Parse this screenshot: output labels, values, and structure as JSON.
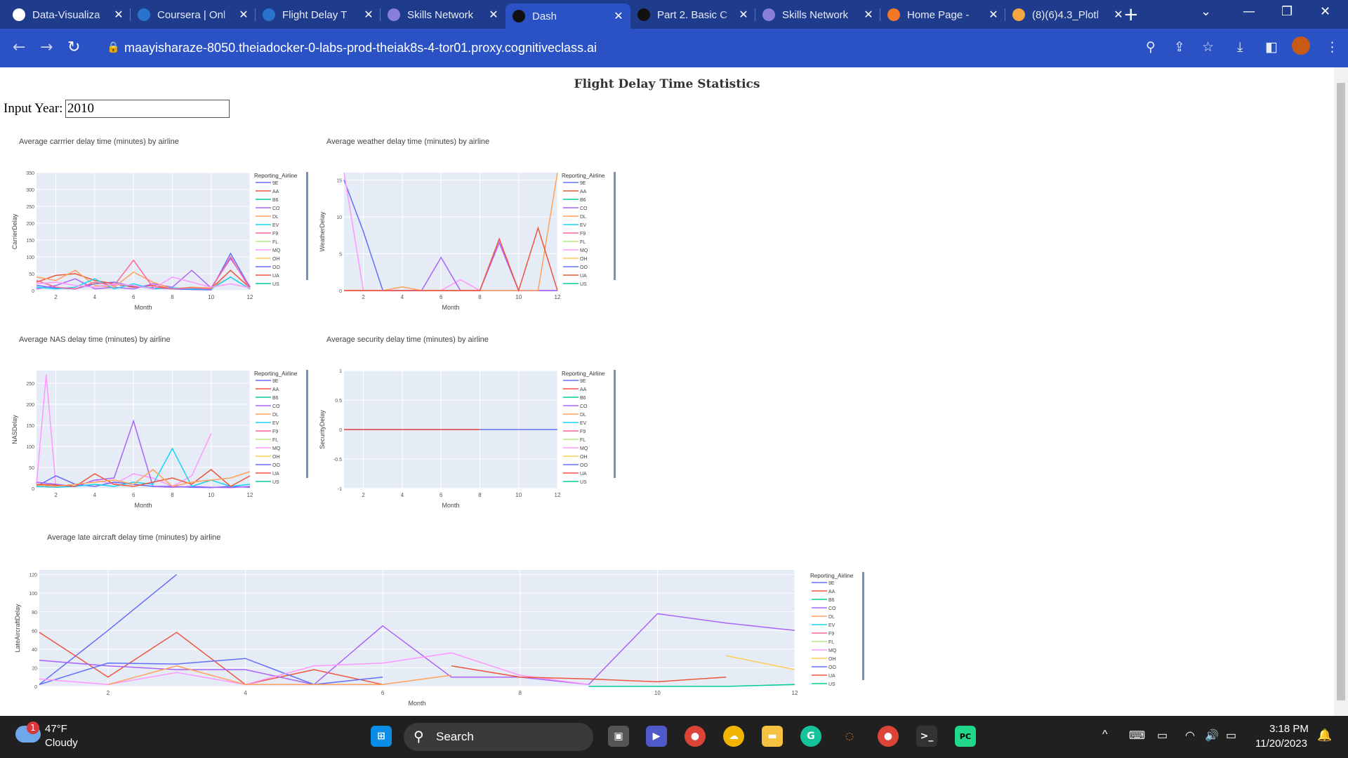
{
  "browser": {
    "tabs": [
      {
        "title": "Data-Visualiza",
        "icon": "github-icon",
        "color": "#ffffff"
      },
      {
        "title": "Coursera | Onl",
        "icon": "coursera-icon",
        "color": "#2a73cc"
      },
      {
        "title": "Flight Delay T",
        "icon": "coursera-icon",
        "color": "#2a73cc"
      },
      {
        "title": "Skills Network",
        "icon": "skills-network-icon",
        "color": "#8a7fd8"
      },
      {
        "title": "Dash",
        "icon": "dash-icon",
        "color": "#111111",
        "active": true
      },
      {
        "title": "Part 2. Basic C",
        "icon": "dash-icon",
        "color": "#111111"
      },
      {
        "title": "Skills Network",
        "icon": "skills-network-icon",
        "color": "#8a7fd8"
      },
      {
        "title": "Home Page - ",
        "icon": "jupyter-icon",
        "color": "#f37726"
      },
      {
        "title": "(8)(6)4.3_Plotl",
        "icon": "book-icon",
        "color": "#f2a541"
      }
    ],
    "url": "maayisharaze-8050.theiadocker-0-labs-prod-theiak8s-4-tor01.proxy.cognitiveclass.ai"
  },
  "page": {
    "title": "Flight Delay Time Statistics",
    "input_label": "Input Year:",
    "input_value": "2010"
  },
  "airlines": [
    "9E",
    "AA",
    "B6",
    "CO",
    "DL",
    "EV",
    "F9",
    "FL",
    "MQ",
    "OH",
    "OO",
    "UA",
    "US"
  ],
  "airline_colors": {
    "9E": "#636efa",
    "AA": "#ef553b",
    "B6": "#00cc96",
    "CO": "#ab63fa",
    "DL": "#ffa15a",
    "EV": "#19d3f3",
    "F9": "#ff6692",
    "FL": "#b6e880",
    "MQ": "#ff97ff",
    "OH": "#fecb52",
    "OO": "#636efa",
    "UA": "#ef553b",
    "US": "#00cc96"
  },
  "legend_title": "Reporting_Airline",
  "chart_data": [
    {
      "type": "line",
      "title": "Average carrrier delay time (minutes) by airline",
      "xlabel": "Month",
      "ylabel": "CarrierDelay",
      "xlim": [
        1,
        12
      ],
      "ylim": [
        0,
        350
      ],
      "xticks": [
        2,
        4,
        6,
        8,
        10,
        12
      ],
      "yticks": [
        0,
        50,
        100,
        150,
        200,
        250,
        300,
        350
      ],
      "series": [
        {
          "name": "9E",
          "x": [
            1,
            2,
            3,
            4,
            5,
            6,
            7,
            8,
            9,
            10,
            11,
            12
          ],
          "y": [
            15,
            8,
            5,
            20,
            25,
            12,
            8,
            5,
            3,
            2,
            110,
            10
          ]
        },
        {
          "name": "AA",
          "x": [
            1,
            2,
            3,
            4,
            5,
            6,
            7,
            8,
            9,
            10,
            11,
            12
          ],
          "y": [
            25,
            45,
            50,
            30,
            20,
            10,
            15,
            5,
            10,
            5,
            60,
            8
          ]
        },
        {
          "name": "CO",
          "x": [
            1,
            2,
            3,
            4,
            5,
            6,
            7,
            8,
            9,
            10,
            11,
            12
          ],
          "y": [
            5,
            15,
            35,
            5,
            10,
            5,
            20,
            10,
            60,
            8,
            95,
            12
          ]
        },
        {
          "name": "DL",
          "x": [
            1,
            2,
            3,
            4,
            5,
            6,
            7,
            8,
            9,
            10,
            11,
            12
          ],
          "y": [
            40,
            30,
            60,
            15,
            10,
            55,
            25,
            5,
            10,
            8,
            40,
            5
          ]
        },
        {
          "name": "EV",
          "x": [
            1,
            2,
            3,
            4,
            5,
            6,
            7,
            8,
            9,
            10,
            11,
            12
          ],
          "y": [
            10,
            5,
            10,
            35,
            5,
            20,
            5,
            8,
            5,
            5,
            40,
            5
          ]
        },
        {
          "name": "F9",
          "x": [
            1,
            2,
            3,
            4,
            5,
            6,
            7,
            8,
            9,
            10,
            11,
            12
          ],
          "y": [
            30,
            10,
            5,
            25,
            15,
            90,
            10,
            5,
            8,
            5,
            100,
            5
          ]
        },
        {
          "name": "MQ",
          "x": [
            1,
            2,
            3,
            4,
            5,
            6,
            7,
            8,
            9,
            10,
            11,
            12
          ],
          "y": [
            20,
            25,
            15,
            10,
            20,
            15,
            5,
            40,
            25,
            10,
            20,
            8
          ]
        }
      ]
    },
    {
      "type": "line",
      "title": "Average weather delay time (minutes) by airline",
      "xlabel": "Month",
      "ylabel": "WeatherDelay",
      "xlim": [
        1,
        12
      ],
      "ylim": [
        0,
        16
      ],
      "xticks": [
        2,
        4,
        6,
        8,
        10,
        12
      ],
      "yticks": [
        0,
        5,
        10,
        15
      ],
      "series": [
        {
          "name": "9E",
          "x": [
            1,
            2,
            3,
            4,
            5,
            6,
            7,
            8,
            9,
            10,
            11,
            12
          ],
          "y": [
            15,
            8,
            0,
            0,
            0,
            0,
            0,
            0,
            0,
            0,
            0,
            0
          ]
        },
        {
          "name": "MQ",
          "x": [
            1,
            2,
            3,
            4,
            5,
            6,
            7,
            8,
            9,
            10,
            11,
            12
          ],
          "y": [
            16,
            0,
            0,
            0,
            0,
            0,
            1.5,
            0,
            7,
            0,
            0,
            0
          ]
        },
        {
          "name": "CO",
          "x": [
            1,
            2,
            3,
            4,
            5,
            6,
            7,
            8,
            9,
            10,
            11,
            12
          ],
          "y": [
            0,
            0,
            0,
            0,
            0,
            4.5,
            0,
            0,
            6.5,
            0,
            0,
            0
          ]
        },
        {
          "name": "DL",
          "x": [
            1,
            2,
            3,
            4,
            5,
            6,
            7,
            8,
            9,
            10,
            11,
            12
          ],
          "y": [
            0,
            0,
            0,
            0.5,
            0,
            0,
            0,
            0,
            0,
            0,
            0,
            16
          ]
        },
        {
          "name": "UA",
          "x": [
            1,
            2,
            3,
            4,
            5,
            6,
            7,
            8,
            9,
            10,
            11,
            12
          ],
          "y": [
            0,
            0,
            0,
            0,
            0,
            0,
            0,
            0,
            7,
            0,
            8.5,
            0
          ]
        }
      ]
    },
    {
      "type": "line",
      "title": "Average NAS delay time (minutes) by airline",
      "xlabel": "Month",
      "ylabel": "NASDelay",
      "xlim": [
        1,
        12
      ],
      "ylim": [
        0,
        280
      ],
      "xticks": [
        2,
        4,
        6,
        8,
        10,
        12
      ],
      "yticks": [
        0,
        50,
        100,
        150,
        200,
        250
      ],
      "series": [
        {
          "name": "MQ",
          "x": [
            1,
            1.5,
            2,
            3,
            4,
            5,
            6,
            7,
            8,
            9,
            10
          ],
          "y": [
            10,
            270,
            5,
            5,
            20,
            10,
            35,
            25,
            5,
            30,
            130
          ]
        },
        {
          "name": "9E",
          "x": [
            1,
            2,
            3,
            4,
            5,
            6,
            7,
            8,
            9,
            10,
            11,
            12
          ],
          "y": [
            5,
            30,
            10,
            5,
            15,
            10,
            5,
            5,
            3,
            2,
            5,
            3
          ]
        },
        {
          "name": "CO",
          "x": [
            1,
            2,
            3,
            4,
            5,
            6,
            7,
            8,
            9,
            10,
            11,
            12
          ],
          "y": [
            15,
            10,
            5,
            20,
            25,
            160,
            5,
            3,
            5,
            3,
            2,
            5
          ]
        },
        {
          "name": "EV",
          "x": [
            1,
            2,
            3,
            4,
            5,
            6,
            7,
            8,
            9,
            10,
            11,
            12
          ],
          "y": [
            5,
            3,
            5,
            10,
            5,
            15,
            10,
            95,
            5,
            20,
            5,
            10
          ]
        },
        {
          "name": "AA",
          "x": [
            1,
            2,
            3,
            4,
            5,
            6,
            7,
            8,
            9,
            10,
            11,
            12
          ],
          "y": [
            10,
            8,
            5,
            35,
            10,
            5,
            15,
            25,
            10,
            45,
            5,
            30
          ]
        },
        {
          "name": "DL",
          "x": [
            1,
            2,
            3,
            4,
            5,
            6,
            7,
            8,
            9,
            10,
            11,
            12
          ],
          "y": [
            8,
            5,
            10,
            15,
            20,
            10,
            45,
            5,
            15,
            20,
            25,
            40
          ]
        }
      ]
    },
    {
      "type": "line",
      "title": "Average security delay time (minutes) by airline",
      "xlabel": "Month",
      "ylabel": "SecurityDelay",
      "xlim": [
        1,
        12
      ],
      "ylim": [
        -1,
        1
      ],
      "xticks": [
        2,
        4,
        6,
        8,
        10,
        12
      ],
      "yticks": [
        -1,
        -0.5,
        0,
        0.5,
        1
      ],
      "series": [
        {
          "name": "9E",
          "x": [
            1,
            12
          ],
          "y": [
            0,
            0
          ]
        },
        {
          "name": "AA",
          "x": [
            1,
            8
          ],
          "y": [
            0,
            0
          ]
        }
      ]
    },
    {
      "type": "line",
      "title": "Average late aircraft delay time (minutes) by airline",
      "xlabel": "Month",
      "ylabel": "LateAircraftDelay",
      "xlim": [
        1,
        12
      ],
      "ylim": [
        0,
        125
      ],
      "xticks": [
        2,
        4,
        6,
        8,
        10,
        12
      ],
      "yticks": [
        0,
        20,
        40,
        60,
        80,
        100,
        120
      ],
      "series": [
        {
          "name": "9E",
          "x": [
            1,
            2,
            3
          ],
          "y": [
            2,
            60,
            120
          ]
        },
        {
          "name": "AA",
          "x": [
            1,
            2,
            3,
            4,
            5,
            6
          ],
          "y": [
            58,
            10,
            58,
            2,
            18,
            2
          ]
        },
        {
          "name": "CO",
          "x": [
            1,
            2,
            3,
            4,
            5,
            6,
            7,
            8,
            9,
            10,
            11,
            12
          ],
          "y": [
            28,
            22,
            18,
            18,
            2,
            65,
            10,
            10,
            2,
            78,
            68,
            60
          ]
        },
        {
          "name": "OO",
          "x": [
            1,
            2,
            3,
            4,
            5,
            6
          ],
          "y": [
            2,
            25,
            24,
            30,
            2,
            10
          ]
        },
        {
          "name": "MQ",
          "x": [
            1,
            2,
            3,
            4,
            5,
            6,
            7,
            8,
            9
          ],
          "y": [
            8,
            2,
            15,
            2,
            22,
            25,
            36,
            12,
            2
          ]
        },
        {
          "name": "DL",
          "x": [
            2,
            3,
            4,
            5,
            6,
            7
          ],
          "y": [
            2,
            22,
            2,
            2,
            2,
            12
          ]
        },
        {
          "name": "UA",
          "x": [
            7,
            8,
            9,
            10,
            11
          ],
          "y": [
            22,
            10,
            8,
            5,
            10
          ]
        },
        {
          "name": "OH",
          "x": [
            11,
            12
          ],
          "y": [
            33,
            18
          ]
        },
        {
          "name": "US",
          "x": [
            9,
            10,
            11,
            12
          ],
          "y": [
            0,
            0,
            0,
            2
          ]
        }
      ]
    }
  ],
  "taskbar": {
    "weather_temp": "47°F",
    "weather_desc": "Cloudy",
    "notif_count": "1",
    "search_label": "Search",
    "time": "3:18 PM",
    "date": "11/20/2023"
  }
}
